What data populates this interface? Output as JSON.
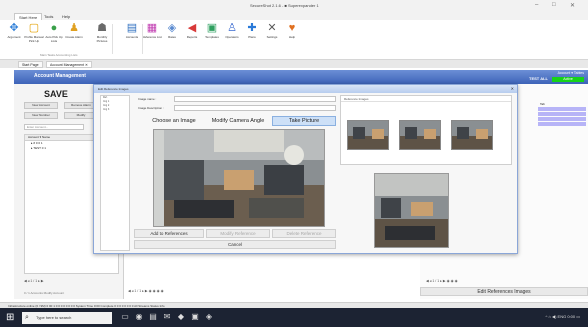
{
  "window": {
    "title": "SecureShot 2.1.6 - ■ Superexpander 1",
    "minimize_glyph": "–",
    "maximize_glyph": "□",
    "close_glyph": "✕"
  },
  "ribbon_tabs": [
    "Start Here",
    "Tools",
    "Help"
  ],
  "ribbon": {
    "buttons": [
      {
        "label": "Argument",
        "icon": "arrows-icon",
        "glyph": "✥",
        "color": "#2f7fd8"
      },
      {
        "label": "Profile Manual Pick Up",
        "icon": "profile-icon",
        "glyph": "▢",
        "color": "#e3a000"
      },
      {
        "label": "Auto Pick Up Lists",
        "icon": "lists-icon",
        "glyph": "●",
        "color": "#3aa04a"
      },
      {
        "label": "Create Alarm",
        "icon": "alarm-icon",
        "glyph": "♟",
        "color": "#e0a020"
      },
      {
        "label": "Monthly Pictures",
        "icon": "pictures-icon",
        "glyph": "☗",
        "color": "#6a6a6a"
      },
      {
        "label": "Accounts",
        "icon": "accounts-icon",
        "glyph": "▤",
        "color": "#2f6fc0"
      },
      {
        "label": "Reference List",
        "icon": "reference-icon",
        "glyph": "▦",
        "color": "#c03ab0"
      },
      {
        "label": "Rates",
        "icon": "rates-icon",
        "glyph": "◈",
        "color": "#5a8ad0"
      },
      {
        "label": "Reports",
        "icon": "reports-icon",
        "glyph": "◀",
        "color": "#d83a3a"
      },
      {
        "label": "Templates",
        "icon": "templates-icon",
        "glyph": "▣",
        "color": "#2fa060"
      },
      {
        "label": "Operators",
        "icon": "operators-icon",
        "glyph": "♙",
        "color": "#3a6ad0"
      },
      {
        "label": "Plans",
        "icon": "plans-icon",
        "glyph": "✚",
        "color": "#2a7ad8"
      },
      {
        "label": "Settings",
        "icon": "settings-icon",
        "glyph": "✕",
        "color": "#5a5a5a"
      },
      {
        "label": "Help",
        "icon": "help-icon",
        "glyph": "♥",
        "color": "#e07020"
      }
    ],
    "group_label": "Main Tasks   Accounting   Lists"
  },
  "doc_tabs": [
    "Start Page",
    "Account Management  ✕"
  ],
  "main": {
    "header_title": "Account Management",
    "header_right_top": "Account  ▾  Tables",
    "header_right_name": "TEST ALL",
    "status_badge": "Active"
  },
  "left_panel": {
    "save_label": "SAVE",
    "new_account_label": "New Account",
    "remove_label": "Remove Alarm",
    "new_number_label": "New Number",
    "modify_label": "Modify",
    "search_placeholder": "Enter Account...",
    "table_header": "Account  ▾ Name",
    "rows": [
      "▸  # 0 0 1",
      "▸  TEST 0 1"
    ],
    "pager": "◀  ◂   1 / 1  ▸  ▶",
    "footer": "0 / 1 Accounts     Modify Account"
  },
  "dialog": {
    "title": "Edit Reference Images",
    "close_glyph": "✕",
    "tree_items": [
      "Ref.",
      "Img 1",
      "Img 2",
      "Img 3"
    ],
    "image_name_label": "Image name :",
    "image_desc_label": "Image Description :",
    "choose_label": "Choose an Image",
    "modify_angle_label": "Modify Camera Angle",
    "take_picture_label": "Take Picture",
    "add_label": "Add to References",
    "modify_ref_label": "Modify Reference",
    "delete_ref_label": "Delete Reference",
    "cancel_label": "Cancel",
    "ref_panel_title": "Reference Images"
  },
  "right_panel": {
    "col_header": "Tab",
    "pager": "◀ ◂  1 / 1  ▸ ▶  ◉ ◉ ◉",
    "edit_refs_label": "Edit References Images"
  },
  "mid_pager": "◀ ◂  1 / 1  ▸ ▶  ◉ ◉ ◉ ◉",
  "status_bar": "Infrastructure online (0 / 9M)    0 00 1 0 0 0 0 0 0 0 0    System Time 0:00 Complete    0 0 0 0 0 0 0 0    All Streams    Status Info",
  "taskbar": {
    "search_placeholder": "Type here to search",
    "tray_text": "^  ⌂  ◀)  ENG  0:00  ▭"
  }
}
